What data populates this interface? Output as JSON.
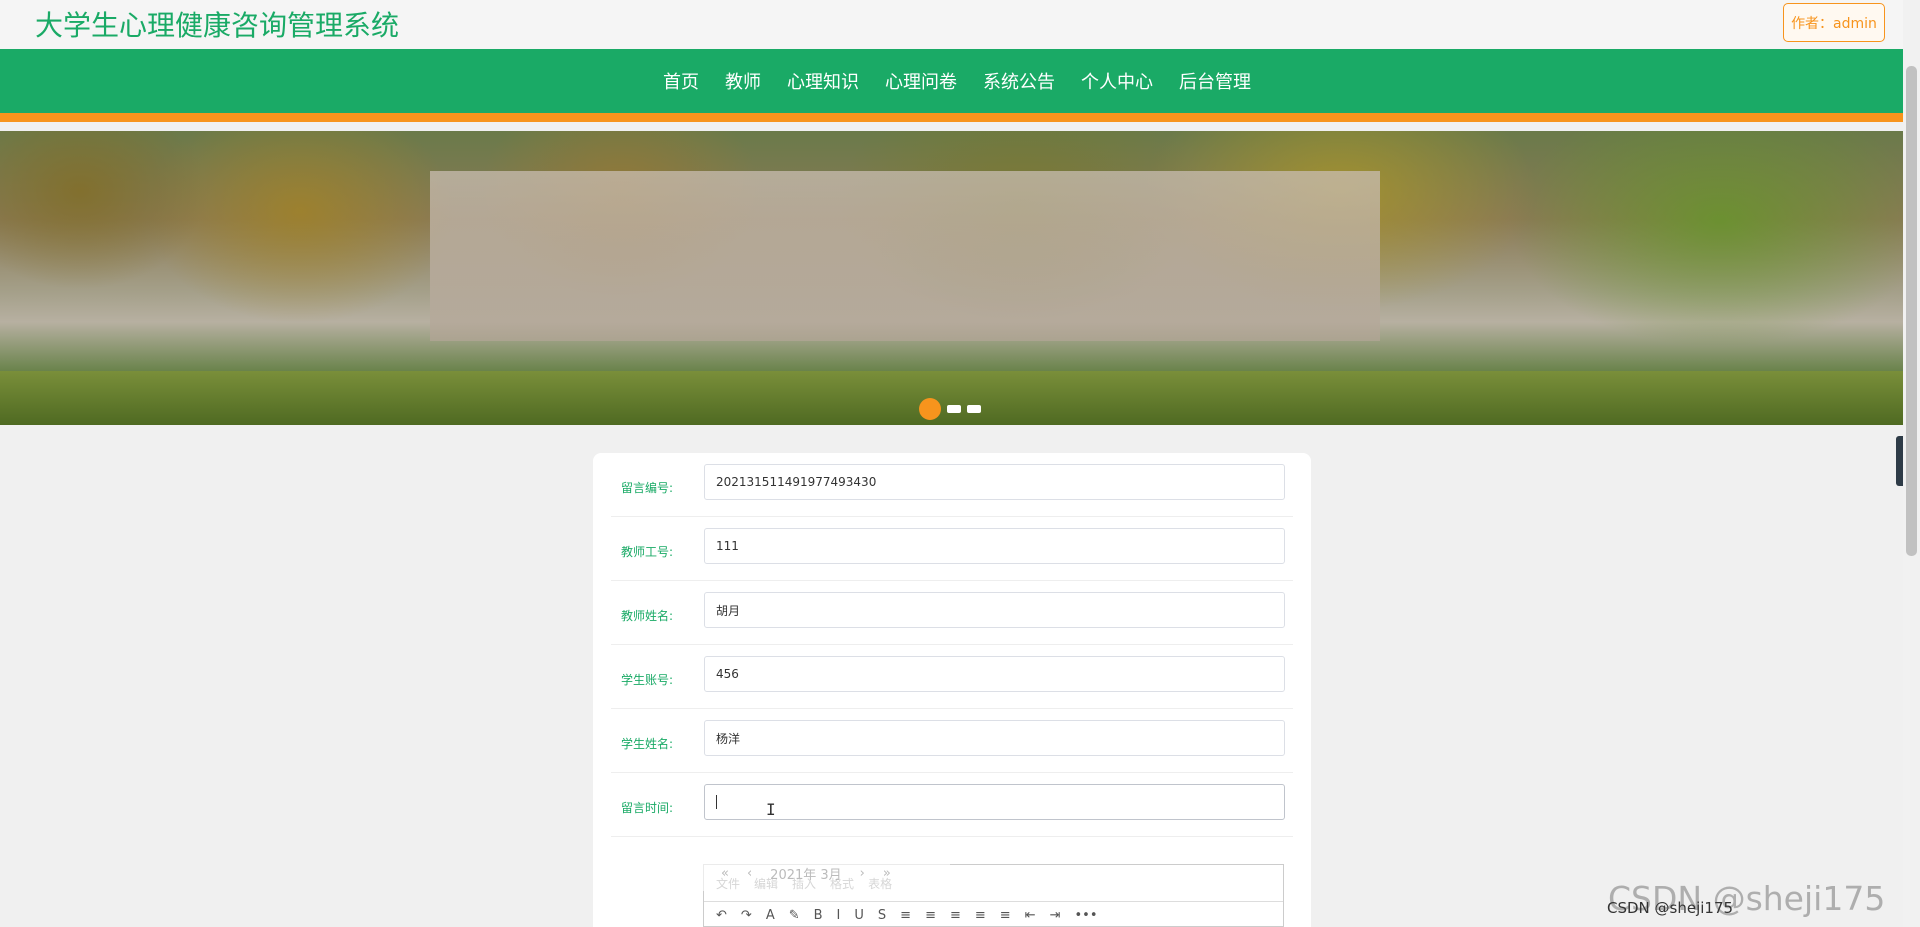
{
  "header": {
    "site_title": "大学生心理健康咨询管理系统",
    "author_label": "作者：admin"
  },
  "nav": {
    "items": [
      "首页",
      "教师",
      "心理知识",
      "心理问卷",
      "系统公告",
      "个人中心",
      "后台管理"
    ]
  },
  "banner": {
    "slide_count": 3,
    "active_slide": 1
  },
  "form": {
    "fields": [
      {
        "label": "留言编号:",
        "value": "202131511491977493430"
      },
      {
        "label": "教师工号:",
        "value": "111"
      },
      {
        "label": "教师姓名:",
        "value": "胡月"
      },
      {
        "label": "学生账号:",
        "value": "456"
      },
      {
        "label": "学生姓名:",
        "value": "杨洋"
      },
      {
        "label": "留言时间:",
        "value": ""
      }
    ]
  },
  "datepicker": {
    "prev_year": "«",
    "prev_month": "‹",
    "title": "2021年 3月",
    "next_month": "›",
    "next_year": "»"
  },
  "editor": {
    "menu": [
      "文件",
      "编辑",
      "插入",
      "格式",
      "表格"
    ],
    "toolbar": [
      "↶",
      "↷",
      "A",
      "✎",
      "B",
      "I",
      "U",
      "S",
      "≡",
      "≡",
      "≡",
      "≡",
      "≡",
      "⇤",
      "⇥",
      "•••"
    ]
  },
  "watermark": {
    "text": "CSDN @sheji175",
    "sub": "CSDN @sheji175"
  },
  "colors": {
    "primary": "#1aaa66",
    "accent": "#f7941d"
  }
}
